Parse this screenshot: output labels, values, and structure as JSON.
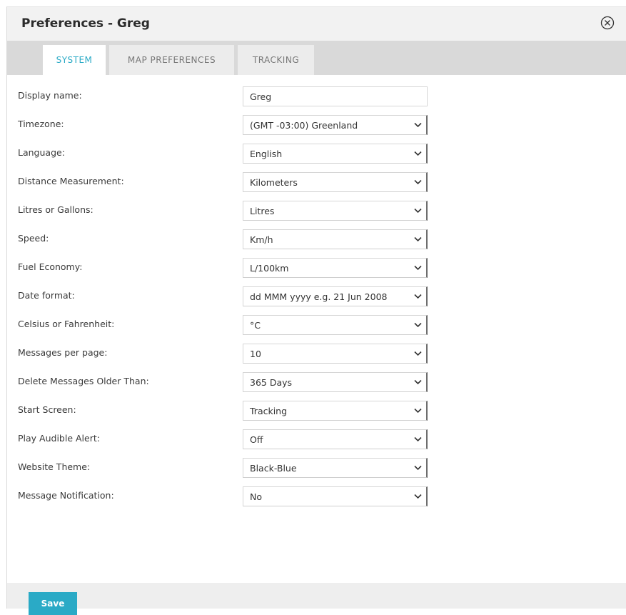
{
  "dialog": {
    "title": "Preferences - Greg",
    "close_icon": "close-circle-x-icon"
  },
  "tabs": [
    {
      "label": "SYSTEM",
      "active": true
    },
    {
      "label": "MAP PREFERENCES",
      "active": false
    },
    {
      "label": "TRACKING",
      "active": false
    }
  ],
  "fields": [
    {
      "label": "Display name:",
      "type": "text",
      "value": "Greg"
    },
    {
      "label": "Timezone:",
      "type": "select",
      "value": "(GMT -03:00) Greenland"
    },
    {
      "label": "Language:",
      "type": "select",
      "value": "English"
    },
    {
      "label": "Distance Measurement:",
      "type": "select",
      "value": "Kilometers"
    },
    {
      "label": "Litres or Gallons:",
      "type": "select",
      "value": "Litres"
    },
    {
      "label": "Speed:",
      "type": "select",
      "value": "Km/h"
    },
    {
      "label": "Fuel Economy:",
      "type": "select",
      "value": "L/100km"
    },
    {
      "label": "Date format:",
      "type": "select",
      "value": "dd MMM yyyy e.g. 21 Jun 2008"
    },
    {
      "label": "Celsius or Fahrenheit:",
      "type": "select",
      "value": "°C"
    },
    {
      "label": "Messages per page:",
      "type": "select",
      "value": "10"
    },
    {
      "label": "Delete Messages Older Than:",
      "type": "select",
      "value": "365 Days"
    },
    {
      "label": "Start Screen:",
      "type": "select",
      "value": "Tracking"
    },
    {
      "label": "Play Audible Alert:",
      "type": "select",
      "value": "Off"
    },
    {
      "label": "Website Theme:",
      "type": "select",
      "value": "Black-Blue"
    },
    {
      "label": "Message Notification:",
      "type": "select",
      "value": "No"
    }
  ],
  "footer": {
    "save_label": "Save"
  },
  "colors": {
    "accent": "#2aaac6",
    "titlebar_bg": "#f2f2f2",
    "tabbar_bg": "#d9d9d9",
    "footer_bg": "#eeeeee"
  }
}
